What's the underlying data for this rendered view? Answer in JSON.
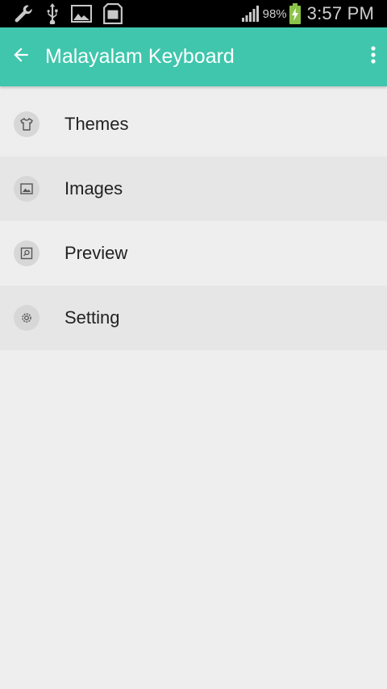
{
  "status_bar": {
    "icons": [
      "wrench-icon",
      "usb-icon",
      "gallery-icon",
      "sd-card-icon"
    ],
    "battery_percent": "98%",
    "time": "3:57 PM"
  },
  "app_bar": {
    "title": "Malayalam Keyboard",
    "background": "#3fc6ad"
  },
  "menu": {
    "items": [
      {
        "label": "Themes",
        "icon": "shirt-icon"
      },
      {
        "label": "Images",
        "icon": "image-icon"
      },
      {
        "label": "Preview",
        "icon": "preview-icon"
      },
      {
        "label": "Setting",
        "icon": "settings-gear-icon"
      }
    ]
  }
}
